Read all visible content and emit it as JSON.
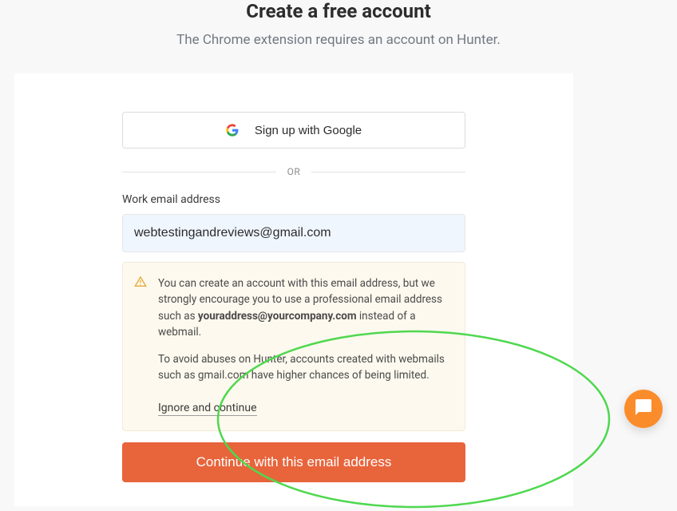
{
  "header": {
    "title": "Create a free account",
    "subtitle": "The Chrome extension requires an account on Hunter."
  },
  "google": {
    "label": "Sign up with Google"
  },
  "divider": {
    "text": "OR"
  },
  "email": {
    "label": "Work email address",
    "value": "webtestingandreviews@gmail.com"
  },
  "warning": {
    "line1_a": "You can create an account with this email address, but we strongly encourage you to use a professional email address such as ",
    "line1_bold": "youraddress@yourcompany.com",
    "line1_b": " instead of a webmail.",
    "line2": "To avoid abuses on Hunter, accounts created with webmails such as gmail.com have higher chances of being limited.",
    "ignore": "Ignore and continue"
  },
  "continue": {
    "label": "Continue with this email address"
  }
}
